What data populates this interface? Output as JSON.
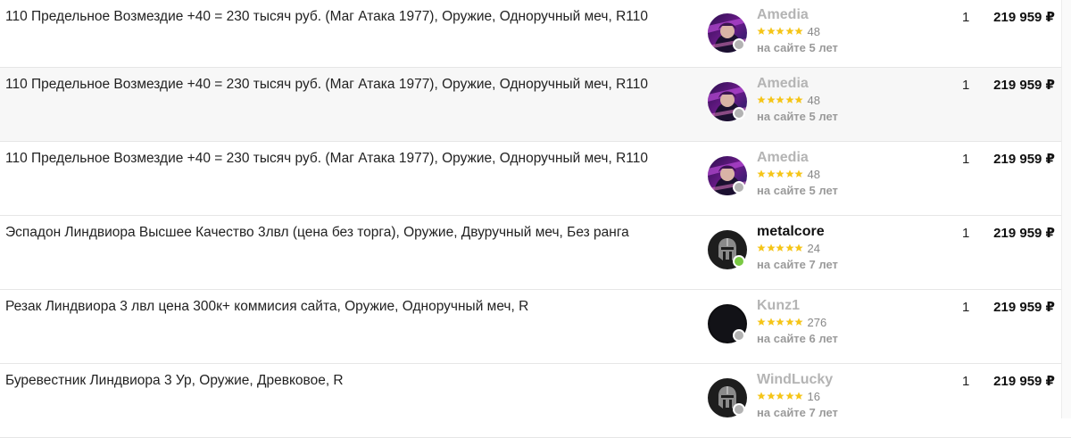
{
  "offers": [
    {
      "description": "110 Предельное Возмездие +40 = 230 тысяч руб. (Маг Атака 1977), Оружие, Одноручный меч, R110",
      "seller": {
        "name": "Amedia",
        "name_color": "#b4b4b4",
        "avatar": "anime-character-avatar",
        "status": "offline",
        "status_color": "#b3b3b3",
        "stars": 5,
        "reviews": "48",
        "member_since": "на сайте 5 лет"
      },
      "quantity": "1",
      "price": "219 959 ₽"
    },
    {
      "description": "110 Предельное Возмездие +40 = 230 тысяч руб. (Маг Атака 1977), Оружие, Одноручный меч, R110",
      "seller": {
        "name": "Amedia",
        "name_color": "#b4b4b4",
        "avatar": "anime-character-avatar",
        "status": "offline",
        "status_color": "#b3b3b3",
        "stars": 5,
        "reviews": "48",
        "member_since": "на сайте 5 лет"
      },
      "quantity": "1",
      "price": "219 959 ₽"
    },
    {
      "description": "110 Предельное Возмездие +40 = 230 тысяч руб. (Маг Атака 1977), Оружие, Одноручный меч, R110",
      "seller": {
        "name": "Amedia",
        "name_color": "#b4b4b4",
        "avatar": "anime-character-avatar",
        "status": "offline",
        "status_color": "#b3b3b3",
        "stars": 5,
        "reviews": "48",
        "member_since": "на сайте 5 лет"
      },
      "quantity": "1",
      "price": "219 959 ₽"
    },
    {
      "description": "Эспадон Линдвиора Высшее Качество 3лвл (цена без торга), Оружие, Двуручный меч, Без ранга",
      "seller": {
        "name": "metalcore",
        "name_color": "#111111",
        "avatar": "helmet-avatar",
        "status": "online",
        "status_color": "#7ac943",
        "stars": 5,
        "reviews": "24",
        "member_since": "на сайте 7 лет"
      },
      "quantity": "1",
      "price": "219 959 ₽"
    },
    {
      "description": "Резак Линдвиора 3 лвл цена 300к+ коммисия сайта, Оружие, Одноручный меч, R",
      "seller": {
        "name": "Kunz1",
        "name_color": "#b4b4b4",
        "avatar": "black-circle-avatar",
        "status": "offline",
        "status_color": "#b3b3b3",
        "stars": 5,
        "reviews": "276",
        "member_since": "на сайте 6 лет"
      },
      "quantity": "1",
      "price": "219 959 ₽"
    },
    {
      "description": "Буревестник Линдвиора 3 Ур, Оружие, Древковое, R",
      "seller": {
        "name": "WindLucky",
        "name_color": "#b4b4b4",
        "avatar": "helmet-avatar",
        "status": "offline",
        "status_color": "#b3b3b3",
        "stars": 5,
        "reviews": "16",
        "member_since": "на сайте 7 лет"
      },
      "quantity": "1",
      "price": "219 959 ₽"
    }
  ],
  "colors": {
    "star": "#f5c518",
    "row_alt_bg": "#f7f7f7",
    "divider": "#e6e6e6"
  }
}
